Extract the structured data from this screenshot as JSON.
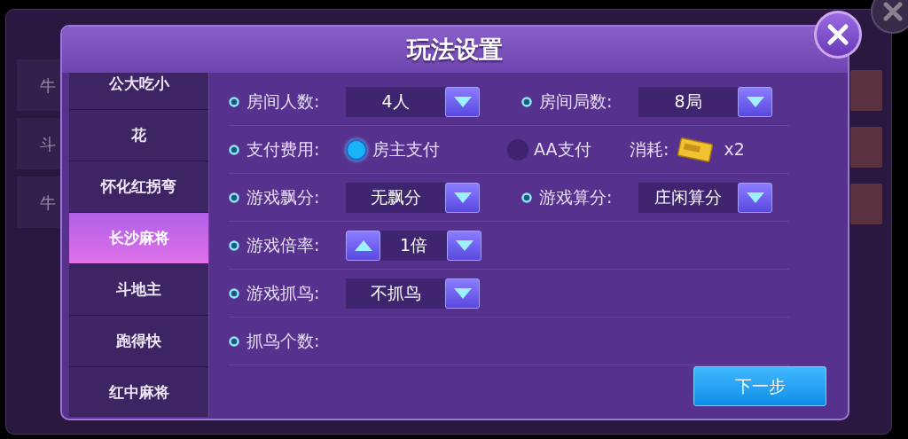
{
  "background_rows": [
    {
      "label": "牛"
    },
    {
      "label": "斗"
    },
    {
      "label": "牛"
    }
  ],
  "dialog": {
    "title": "玩法设置"
  },
  "sidebar": {
    "items": [
      {
        "label": "公大吃小",
        "selected": false
      },
      {
        "label": "花",
        "selected": false
      },
      {
        "label": "怀化红拐弯",
        "selected": false
      },
      {
        "label": "长沙麻将",
        "selected": true
      },
      {
        "label": "斗地主",
        "selected": false
      },
      {
        "label": "跑得快",
        "selected": false
      },
      {
        "label": "红中麻将",
        "selected": false
      }
    ]
  },
  "settings": [
    {
      "cells": [
        {
          "kind": "dropdown",
          "label": "房间人数:",
          "value": "4人"
        },
        {
          "kind": "dropdown",
          "label": "房间局数:",
          "value": "8局"
        }
      ]
    },
    {
      "cells": [
        {
          "kind": "radio",
          "label": "支付费用:",
          "options": [
            {
              "label": "房主支付",
              "selected": true
            },
            {
              "label": "AA支付",
              "selected": false
            }
          ]
        },
        {
          "kind": "cost",
          "label": "消耗:",
          "amount": "x2"
        }
      ]
    },
    {
      "cells": [
        {
          "kind": "dropdown",
          "label": "游戏飘分:",
          "value": "无飘分"
        },
        {
          "kind": "dropdown",
          "label": "游戏算分:",
          "value": "庄闲算分"
        }
      ]
    },
    {
      "cells": [
        {
          "kind": "stepper",
          "label": "游戏倍率:",
          "value": "1倍"
        }
      ]
    },
    {
      "cells": [
        {
          "kind": "dropdown",
          "label": "游戏抓鸟:",
          "value": "不抓鸟"
        }
      ]
    },
    {
      "cells": [
        {
          "kind": "label",
          "label": "抓鸟个数:"
        }
      ]
    }
  ],
  "next_button": "下一步"
}
